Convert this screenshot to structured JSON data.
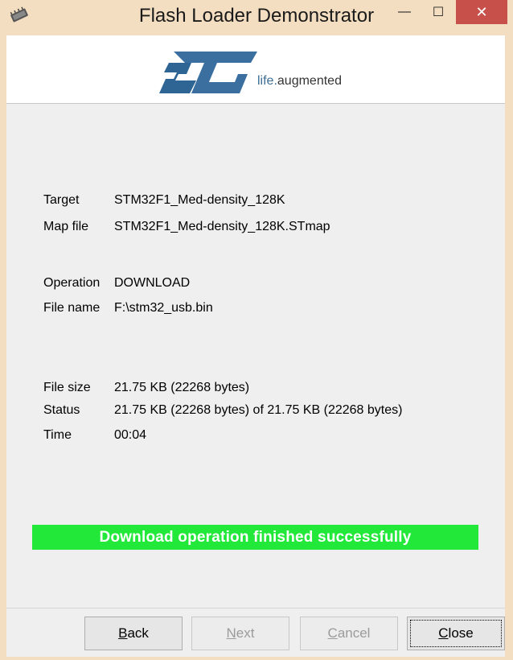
{
  "window": {
    "title": "Flash Loader Demonstrator",
    "minimize_glyph": "—",
    "maximize_glyph": "☐",
    "close_glyph": "✕"
  },
  "banner": {
    "logo_icon": "st-logo",
    "tagline_prefix": "life.",
    "tagline_suffix": "augmented"
  },
  "info": {
    "target_label": "Target",
    "target_value": "STM32F1_Med-density_128K",
    "map_label": "Map file",
    "map_value": "STM32F1_Med-density_128K.STmap",
    "operation_label": "Operation",
    "operation_value": "DOWNLOAD",
    "filename_label": "File name",
    "filename_value": "F:\\stm32_usb.bin",
    "filesize_label": "File size",
    "filesize_value": "21.75 KB (22268 bytes)",
    "status_label": "Status",
    "status_value": "21.75 KB (22268 bytes) of 21.75 KB (22268 bytes)",
    "time_label": "Time",
    "time_value": "00:04"
  },
  "progress": {
    "message": "Download operation finished successfully",
    "color": "#22e83a",
    "fraction": 1.0
  },
  "buttons": {
    "back_mnemonic": "B",
    "back_rest": "ack",
    "next_mnemonic": "N",
    "next_rest": "ext",
    "cancel_mnemonic": "C",
    "cancel_rest": "ancel",
    "close_mnemonic": "C",
    "close_rest": "lose"
  },
  "colors": {
    "st_blue": "#3a6fa0",
    "close_button": "#c7504a"
  }
}
